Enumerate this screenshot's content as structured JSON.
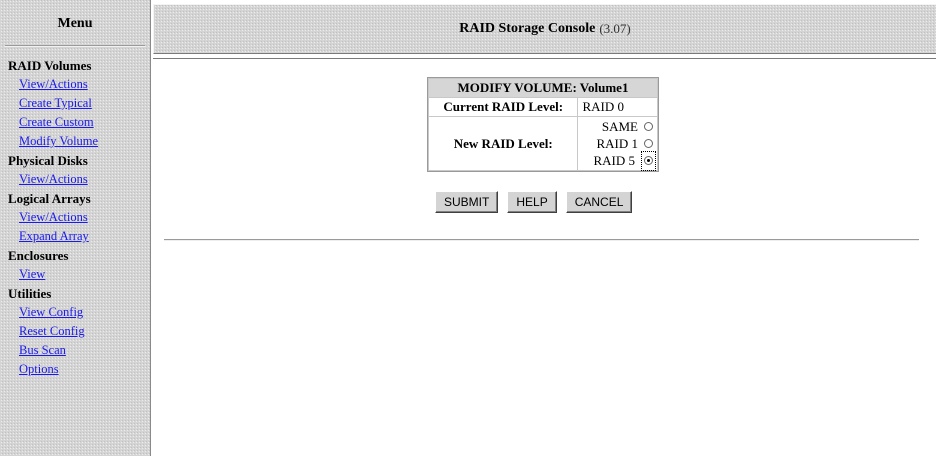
{
  "sidebar": {
    "title": "Menu",
    "sections": [
      {
        "heading": "RAID Volumes",
        "items": [
          "View/Actions",
          "Create Typical",
          "Create Custom",
          "Modify Volume"
        ]
      },
      {
        "heading": "Physical Disks",
        "items": [
          "View/Actions"
        ]
      },
      {
        "heading": "Logical Arrays",
        "items": [
          "View/Actions",
          "Expand Array"
        ]
      },
      {
        "heading": "Enclosures",
        "items": [
          "View"
        ]
      },
      {
        "heading": "Utilities",
        "items": [
          "View Config",
          "Reset Config",
          "Bus Scan",
          "Options"
        ]
      }
    ]
  },
  "header": {
    "title": "RAID Storage Console",
    "version": "(3.07)"
  },
  "form": {
    "heading": "MODIFY VOLUME: Volume1",
    "current_label": "Current RAID Level:",
    "current_value": "RAID 0",
    "new_label": "New RAID Level:",
    "options": [
      {
        "label": "SAME",
        "checked": false
      },
      {
        "label": "RAID 1",
        "checked": false
      },
      {
        "label": "RAID 5",
        "checked": true
      }
    ]
  },
  "buttons": {
    "submit": "SUBMIT",
    "help": "HELP",
    "cancel": "CANCEL"
  }
}
